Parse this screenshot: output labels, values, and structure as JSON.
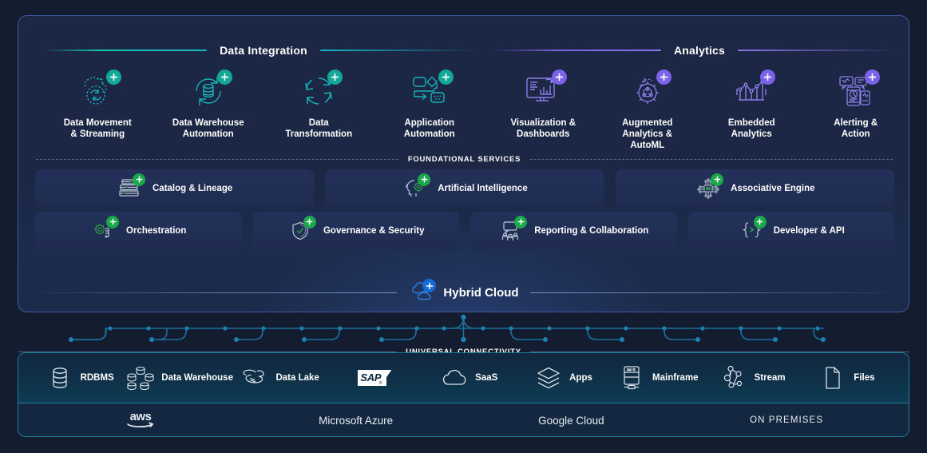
{
  "colors": {
    "page_bg": "#141c30",
    "panel_bg": "#1b2744",
    "panel_border": "#3f5a9b",
    "teal_accent": "#0fc4ab",
    "purple_accent": "#7b63e0",
    "green_accent": "#1aa84a",
    "blue_accent": "#1769d6",
    "connectivity_border": "#1d7f96"
  },
  "sections": {
    "data_integration": {
      "title": "Data Integration",
      "accent": "#0fc4ab",
      "items": [
        {
          "label": "Data Movement\n& Streaming",
          "line1": "Data Movement",
          "line2": "& Streaming",
          "icon": "data-movement-streaming-icon"
        },
        {
          "label": "Data Warehouse Automation",
          "line1": "Data Warehouse",
          "line2": "Automation",
          "icon": "data-warehouse-automation-icon"
        },
        {
          "label": "Data Transformation",
          "line1": "Data",
          "line2": "Transformation",
          "icon": "data-transformation-icon"
        },
        {
          "label": "Application Automation",
          "line1": "Application",
          "line2": "Automation",
          "icon": "application-automation-icon"
        }
      ]
    },
    "analytics": {
      "title": "Analytics",
      "accent": "#7b63e0",
      "items": [
        {
          "label": "Visualization & Dashboards",
          "line1": "Visualization &",
          "line2": "Dashboards",
          "line3": "",
          "icon": "visualization-dashboards-icon"
        },
        {
          "label": "Augmented Analytics & AutoML",
          "line1": "Augmented",
          "line2": "Analytics &",
          "line3": "AutoML",
          "icon": "augmented-analytics-automl-icon"
        },
        {
          "label": "Embedded Analytics",
          "line1": "Embedded",
          "line2": "Analytics",
          "line3": "",
          "icon": "embedded-analytics-icon"
        },
        {
          "label": "Alerting & Action",
          "line1": "Alerting &",
          "line2": "Action",
          "line3": "",
          "icon": "alerting-action-icon"
        }
      ]
    },
    "foundational": {
      "title": "FOUNDATIONAL SERVICES",
      "row1": [
        {
          "label": "Catalog & Lineage",
          "icon": "catalog-lineage-icon"
        },
        {
          "label": "Artificial Intelligence",
          "icon": "artificial-intelligence-icon"
        },
        {
          "label": "Associative Engine",
          "icon": "associative-engine-icon"
        }
      ],
      "row2": [
        {
          "label": "Orchestration",
          "icon": "orchestration-icon"
        },
        {
          "label": "Governance & Security",
          "icon": "governance-security-icon"
        },
        {
          "label": "Reporting & Collaboration",
          "icon": "reporting-collaboration-icon"
        },
        {
          "label": "Developer & API",
          "icon": "developer-api-icon"
        }
      ]
    },
    "hybrid_cloud": {
      "label": "Hybrid Cloud",
      "icon": "hybrid-cloud-icon"
    },
    "universal_connectivity": {
      "title": "UNIVERSAL CONNECTIVITY",
      "sources": [
        {
          "label": "RDBMS",
          "icon": "database-cylinder-icon"
        },
        {
          "label": "Data Warehouse",
          "icon": "data-warehouse-stack-icon"
        },
        {
          "label": "Data Lake",
          "icon": "data-lake-icon"
        },
        {
          "label": "SAP",
          "icon": "sap-logo-icon"
        },
        {
          "label": "SaaS",
          "icon": "cloud-icon"
        },
        {
          "label": "Apps",
          "icon": "layers-icon"
        },
        {
          "label": "Mainframe",
          "icon": "mainframe-icon"
        },
        {
          "label": "Stream",
          "icon": "stream-nodes-icon"
        },
        {
          "label": "Files",
          "icon": "file-document-icon"
        }
      ],
      "platforms": [
        {
          "label": "aws",
          "icon": "aws-logo"
        },
        {
          "label": "Microsoft Azure",
          "icon": "azure-logo"
        },
        {
          "label": "Google Cloud",
          "icon": "google-cloud-logo"
        },
        {
          "label": "ON PREMISES",
          "icon": "on-premises-label"
        }
      ]
    }
  }
}
